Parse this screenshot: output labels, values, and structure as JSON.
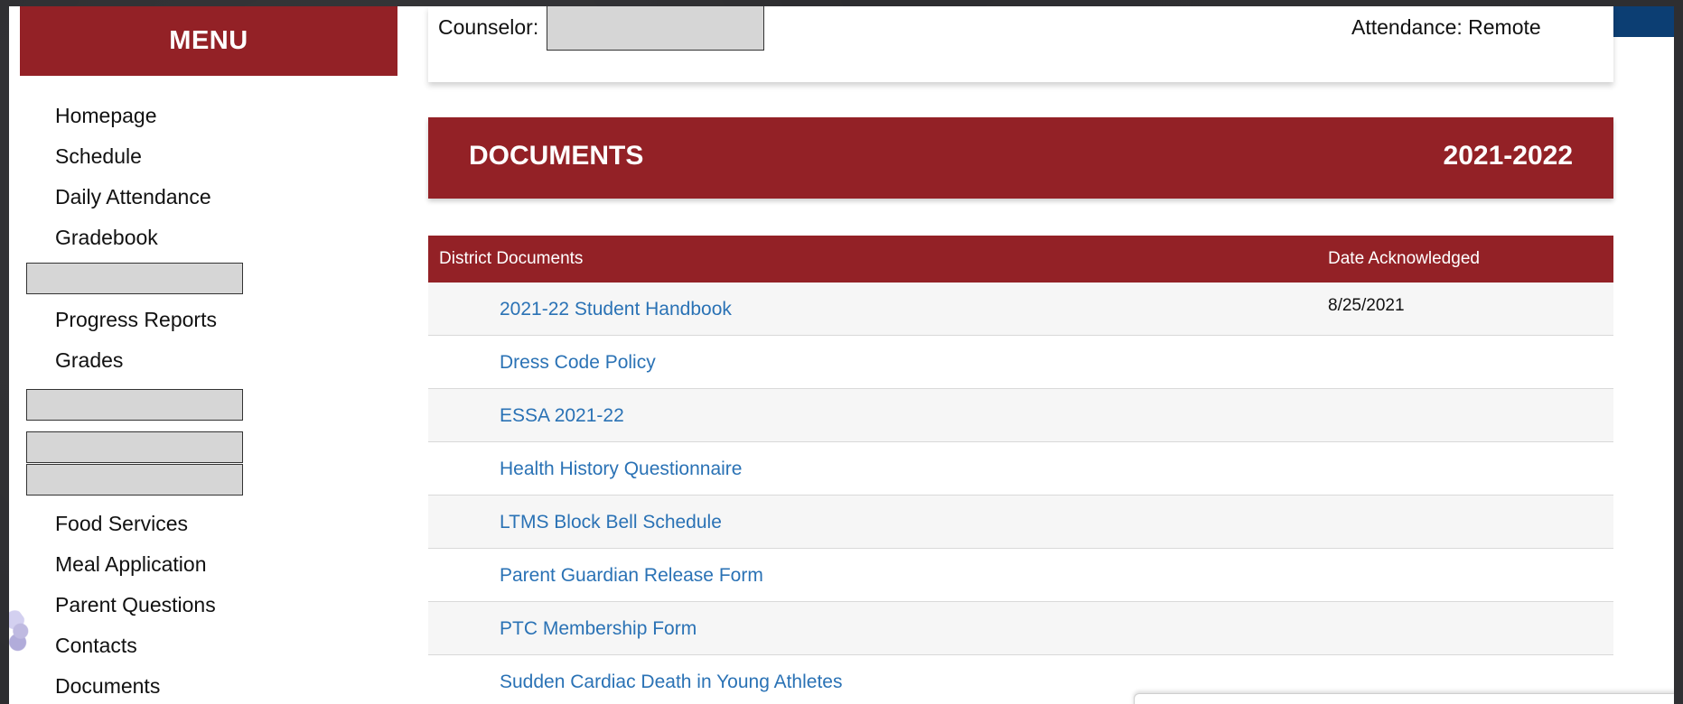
{
  "sidebar": {
    "title": "MENU",
    "items": [
      "Homepage",
      "Schedule",
      "Daily Attendance",
      "Gradebook",
      "Progress Reports",
      "Grades",
      "Food Services",
      "Meal Application",
      "Parent Questions",
      "Contacts",
      "Documents"
    ]
  },
  "info": {
    "counselor_label": "Counselor:",
    "attendance": "Attendance: Remote"
  },
  "documents": {
    "title": "DOCUMENTS",
    "year": "2021-2022"
  },
  "table": {
    "col_document": "District Documents",
    "col_date": "Date Acknowledged",
    "rows": [
      {
        "title": "2021-22 Student Handbook",
        "date": "8/25/2021"
      },
      {
        "title": "Dress Code Policy",
        "date": ""
      },
      {
        "title": "ESSA 2021-22",
        "date": ""
      },
      {
        "title": "Health History Questionnaire",
        "date": ""
      },
      {
        "title": "LTMS Block Bell Schedule",
        "date": ""
      },
      {
        "title": "Parent Guardian Release Form",
        "date": ""
      },
      {
        "title": "PTC Membership Form",
        "date": ""
      },
      {
        "title": "Sudden Cardiac Death in Young Athletes",
        "date": ""
      }
    ]
  },
  "colors": {
    "brand_red": "#932126",
    "link_blue": "#2a72b5",
    "top_bar_blue": "#0c3e73"
  }
}
